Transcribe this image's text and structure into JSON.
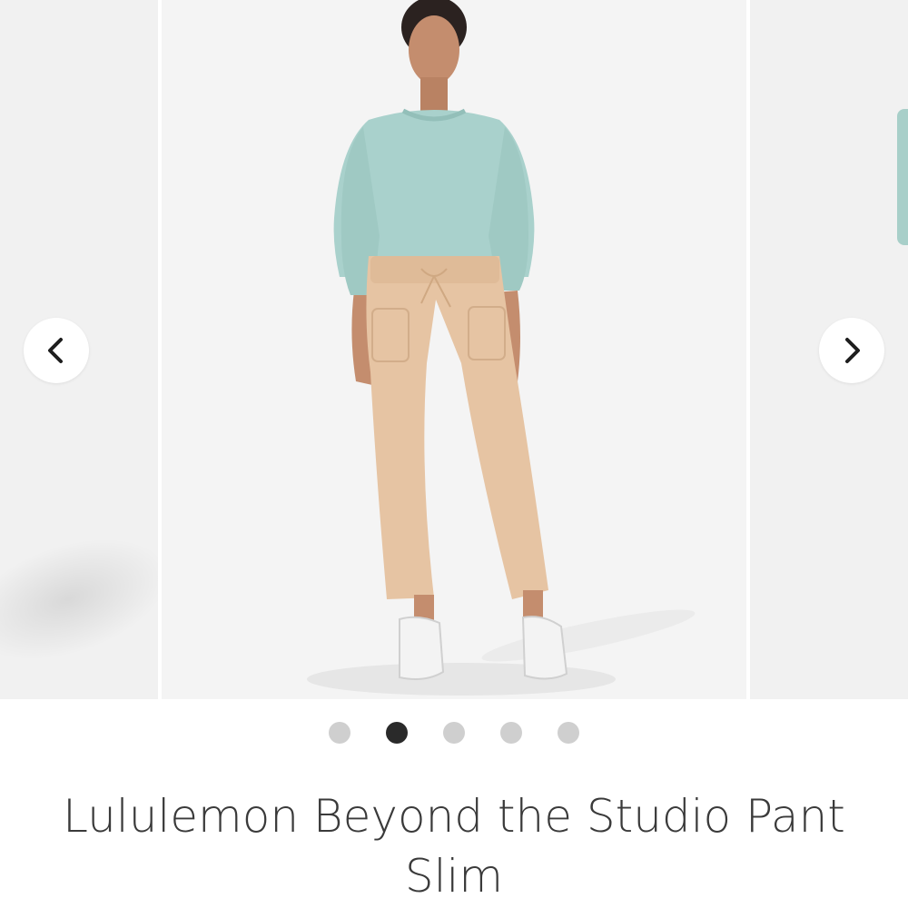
{
  "carousel": {
    "prev_icon": "chevron-left-icon",
    "next_icon": "chevron-right-icon",
    "image": {
      "subject": "product-photo",
      "colors": {
        "sweatshirt": "#a9d1cc",
        "pants": "#e6c4a3",
        "sneakers": "#f2f2f2",
        "background": "#f4f4f4"
      }
    },
    "slide_count": 5,
    "active_slide": 2
  },
  "product": {
    "title": "Lululemon Beyond the Studio Pant Slim"
  },
  "colors": {
    "dot_inactive": "#cfcfcf",
    "dot_active": "#2a2a2a",
    "title_text": "#3a3a3a"
  }
}
